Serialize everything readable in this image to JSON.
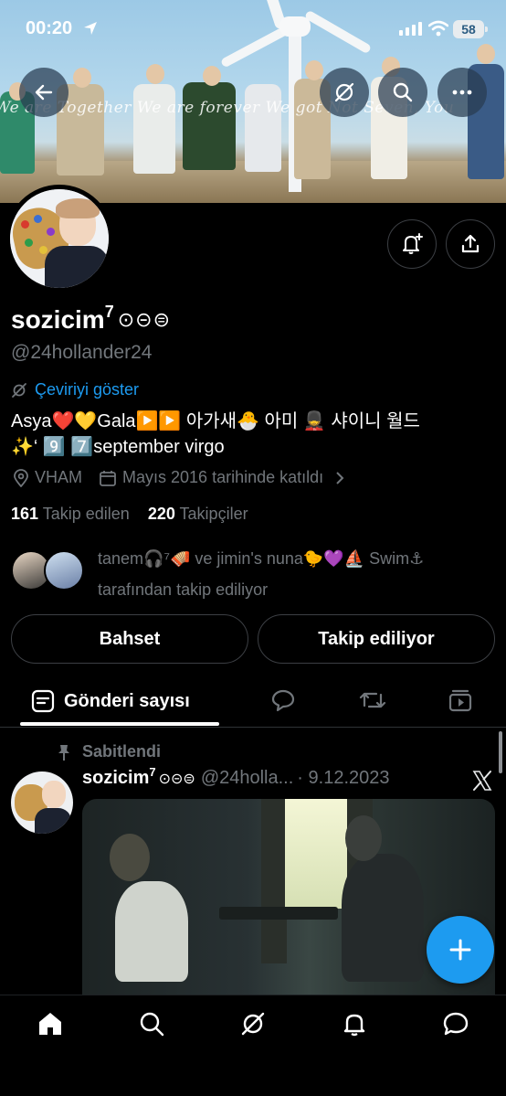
{
  "status_bar": {
    "time": "00:20",
    "battery": "58"
  },
  "banner": {
    "caption": "We are Together We are forever We got Not Seven, You"
  },
  "profile": {
    "name": "sozicim",
    "name_sup": "7",
    "name_symbols": "⊙⊝⊜",
    "handle": "@24hollander24",
    "translate_label": "Çeviriyi göster",
    "bio_line1": "Asya❤️💛Gala▶️▶️ 아가새🐣 아미 💂 샤이니 월드",
    "bio_line2": "✨‘ 9️⃣ 7️⃣september virgo",
    "location": "VHAM",
    "joined": "Mayıs 2016 tarihinde katıldı",
    "following_count": "161",
    "following_label": "Takip edilen",
    "followers_count": "220",
    "followers_label": "Takipçiler",
    "followed_by_line1": "tanem🎧⁷🪗 ve jimin's nuna🐤💜⛵ Swim⚓",
    "followed_by_line2": "tarafından takip ediliyor",
    "mention_button": "Bahset",
    "following_button": "Takip ediliyor"
  },
  "tabs": {
    "active_label": "Gönderi sayısı"
  },
  "tweet": {
    "pinned_label": "Sabitlendi",
    "author_name": "sozicim",
    "author_sup": "7",
    "author_symbols": "⊙⊝⊜",
    "author_handle": "@24holla...",
    "date": "· 9.12.2023"
  },
  "colors": {
    "accent": "#1d9bf0",
    "background": "#000000",
    "secondary_text": "#71767b"
  }
}
